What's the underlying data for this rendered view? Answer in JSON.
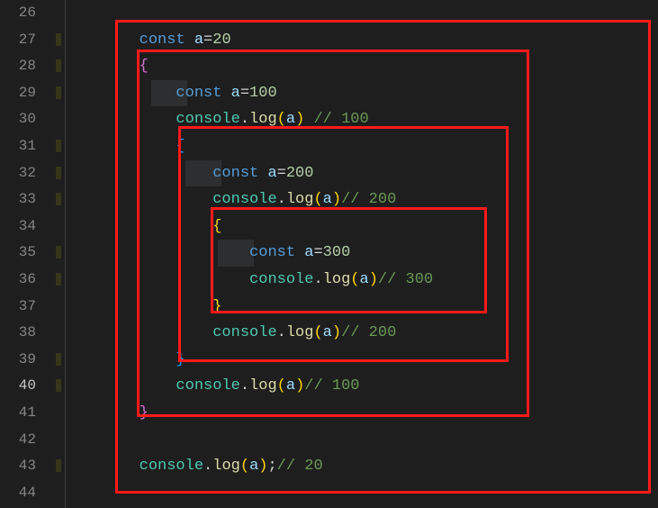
{
  "lines": {
    "start": 26,
    "end": 44,
    "active": 40
  },
  "code": {
    "l27_kw": "const",
    "l27_var": " a",
    "l27_eq": "=",
    "l27_num": "20",
    "l28_brace": "{",
    "l29_kw": "const",
    "l29_var": " a",
    "l29_eq": "=",
    "l29_num": "100",
    "l30_obj": "console",
    "l30_dot": ".",
    "l30_fn": "log",
    "l30_lp": "(",
    "l30_arg": "a",
    "l30_rp": ")",
    "l30_cm": " // 100",
    "l31_brace": "{",
    "l32_kw": "const",
    "l32_var": " a",
    "l32_eq": "=",
    "l32_num": "200",
    "l33_obj": "console",
    "l33_dot": ".",
    "l33_fn": "log",
    "l33_lp": "(",
    "l33_arg": "a",
    "l33_rp": ")",
    "l33_cm": "// 200",
    "l34_brace": "{",
    "l35_kw": "const",
    "l35_var": " a",
    "l35_eq": "=",
    "l35_num": "300",
    "l36_obj": "console",
    "l36_dot": ".",
    "l36_fn": "log",
    "l36_lp": "(",
    "l36_arg": "a",
    "l36_rp": ")",
    "l36_cm": "// 300",
    "l37_brace": "}",
    "l38_obj": "console",
    "l38_dot": ".",
    "l38_fn": "log",
    "l38_lp": "(",
    "l38_arg": "a",
    "l38_rp": ")",
    "l38_cm": "// 200",
    "l39_brace": "}",
    "l40_obj": "console",
    "l40_dot": ".",
    "l40_fn": "log",
    "l40_lp": "(",
    "l40_arg": "a",
    "l40_rp": ")",
    "l40_cm": "// 100",
    "l41_brace": "}",
    "l43_obj": "console",
    "l43_dot": ".",
    "l43_fn": "log",
    "l43_lp": "(",
    "l43_arg": "a",
    "l43_rp": ")",
    "l43_semi": ";",
    "l43_cm": "// 20"
  }
}
